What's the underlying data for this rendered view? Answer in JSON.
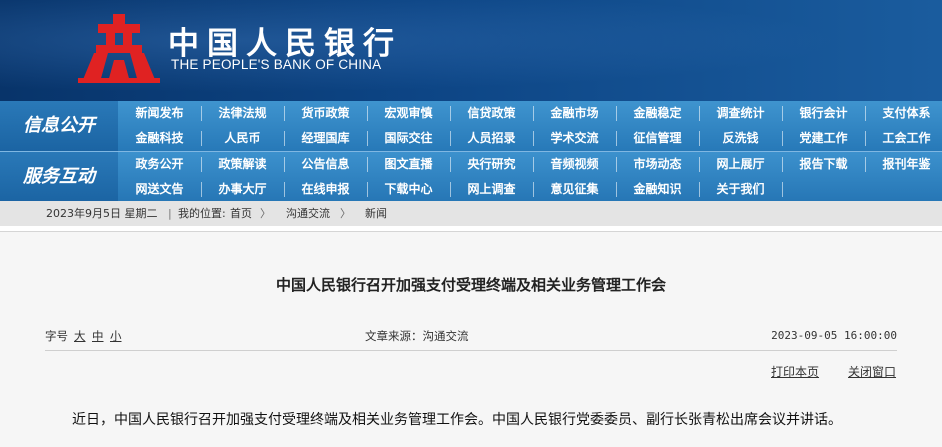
{
  "header": {
    "cn_title": "中国人民银行",
    "en_title": "THE PEOPLE'S BANK OF CHINA",
    "emblem_color": "#e02222"
  },
  "nav": {
    "section1_label": "信息公开",
    "section1_links": [
      "新闻发布",
      "法律法规",
      "货币政策",
      "宏观审慎",
      "信贷政策",
      "金融市场",
      "金融稳定",
      "调查统计",
      "银行会计",
      "支付体系",
      "金融科技",
      "人民币",
      "经理国库",
      "国际交往",
      "人员招录",
      "学术交流",
      "征信管理",
      "反洗钱",
      "党建工作",
      "工会工作"
    ],
    "section2_label": "服务互动",
    "section2_links": [
      "政务公开",
      "政策解读",
      "公告信息",
      "图文直播",
      "央行研究",
      "音频视频",
      "市场动态",
      "网上展厅",
      "报告下载",
      "报刊年鉴",
      "网送文告",
      "办事大厅",
      "在线申报",
      "下载中心",
      "网上调查",
      "意见征集",
      "金融知识",
      "关于我们"
    ]
  },
  "breadcrumb": {
    "date": "2023年9月5日 星期二",
    "location_label": "我的位置:",
    "home": "首页",
    "sep": "〉",
    "level1": "沟通交流",
    "level2": "新闻"
  },
  "article": {
    "title": "中国人民银行召开加强支付受理终端及相关业务管理工作会",
    "font_size_label": "字号",
    "size_large": "大",
    "size_medium": "中",
    "size_small": "小",
    "source": "文章来源：沟通交流",
    "datetime": "2023-09-05 16:00:00",
    "print_label": "打印本页",
    "close_label": "关闭窗口",
    "paragraph": "近日，中国人民银行召开加强支付受理终端及相关业务管理工作会。中国人民银行党委委员、副行长张青松出席会议并讲话。"
  }
}
